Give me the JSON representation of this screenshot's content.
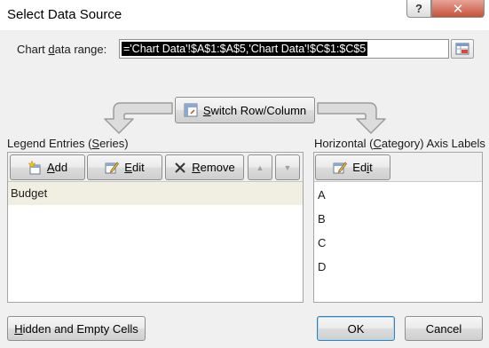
{
  "window": {
    "title": "Select Data Source",
    "help_glyph": "?",
    "close_glyph": "✕"
  },
  "range": {
    "label_pre": "Chart ",
    "label_u": "d",
    "label_post": "ata range:",
    "value": "='Chart Data'!$A$1:$A$5,'Chart Data'!$C$1:$C$5"
  },
  "switch_button": {
    "label_pre": "",
    "label_u": "S",
    "label_post": "witch Row/Column"
  },
  "legend": {
    "title_pre": "Legend Entries (",
    "title_u": "S",
    "title_post": "eries)",
    "add_pre": "",
    "add_u": "A",
    "add_post": "dd",
    "edit_pre": "",
    "edit_u": "E",
    "edit_post": "dit",
    "remove_pre": "",
    "remove_u": "R",
    "remove_post": "emove",
    "move_up_glyph": "▲",
    "move_down_glyph": "▼",
    "items": [
      "Budget"
    ]
  },
  "axis": {
    "title_pre": "Horizontal (",
    "title_u": "C",
    "title_post": "ategory) Axis Labels",
    "edit_pre": "Ed",
    "edit_u": "i",
    "edit_post": "t",
    "items": [
      "A",
      "B",
      "C",
      "D"
    ]
  },
  "footer": {
    "hidden_pre": "",
    "hidden_u": "H",
    "hidden_post": "idden and Empty Cells",
    "ok_label": "OK",
    "cancel_label": "Cancel"
  },
  "colors": {
    "selection_bg": "#000000",
    "series_highlight": "#f1efe2",
    "close_button": "#c7513a"
  }
}
